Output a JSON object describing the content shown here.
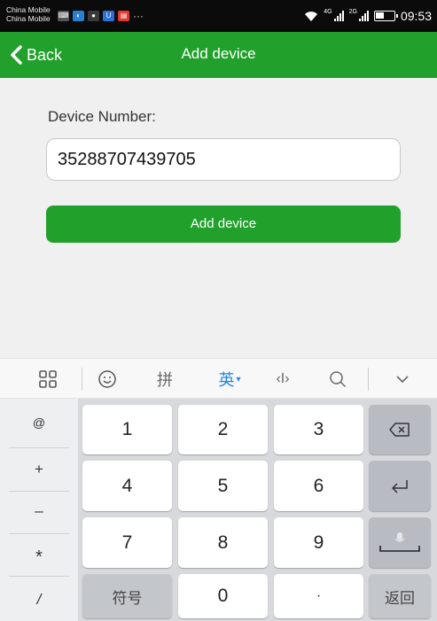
{
  "status_bar": {
    "carrier_1": "China Mobile",
    "carrier_2": "China Mobile",
    "notifications": [
      "keyboard-icon",
      "app-icon",
      "wechat-icon",
      "u-icon",
      "toutiao-icon"
    ],
    "more": "···",
    "net_1": "4G",
    "net_2": "2G",
    "time": "09:53",
    "battery_level": 0.45
  },
  "nav": {
    "back_label": "Back",
    "title": "Add device"
  },
  "form": {
    "label": "Device Number:",
    "device_number": "35288707439705",
    "submit_label": "Add device"
  },
  "keyboard": {
    "toolbar": {
      "pinyin": "拼",
      "english": "英",
      "cursor": "‹I›"
    },
    "symbols": [
      "@",
      "+",
      "–",
      "*",
      "/"
    ],
    "rows": [
      [
        "1",
        "2",
        "3"
      ],
      [
        "4",
        "5",
        "6"
      ],
      [
        "7",
        "8",
        "9"
      ],
      [
        "符号",
        "0",
        "·"
      ]
    ],
    "return_label": "返回"
  },
  "colors": {
    "accent": "#22a02c",
    "toolbar_active": "#1f86e8"
  }
}
